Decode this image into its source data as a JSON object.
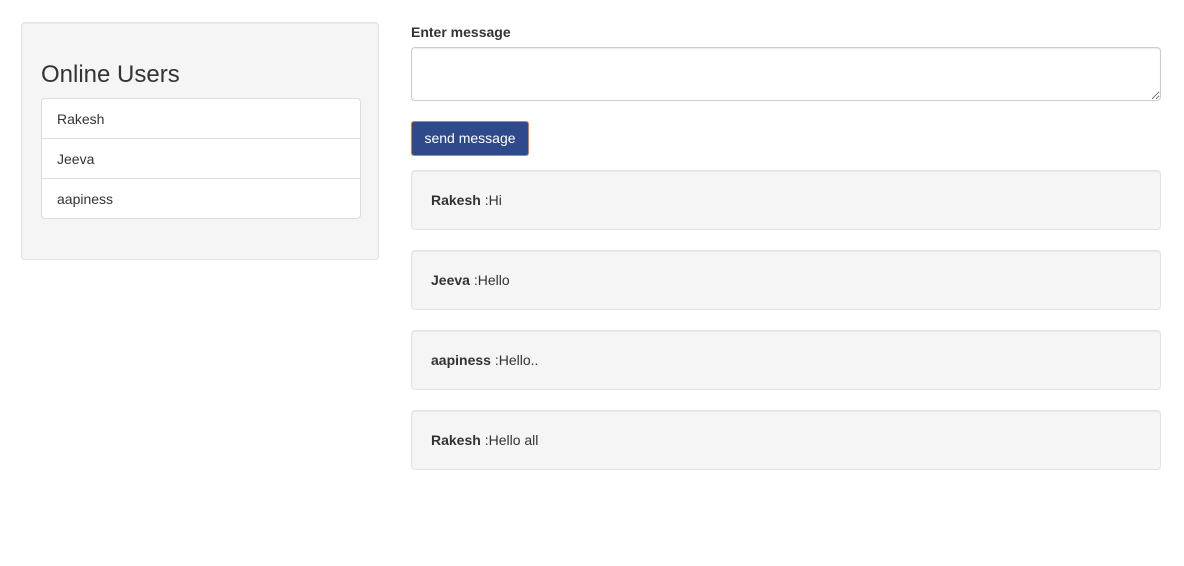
{
  "sidebar": {
    "title": "Online Users",
    "users": [
      "Rakesh",
      "Jeeva",
      "aapiness"
    ]
  },
  "composer": {
    "label": "Enter message",
    "value": "",
    "placeholder": "",
    "send_label": "send message"
  },
  "messages": [
    {
      "sender": "Rakesh",
      "text": " :Hi"
    },
    {
      "sender": "Jeeva",
      "text": " :Hello"
    },
    {
      "sender": "aapiness",
      "text": " :Hello.."
    },
    {
      "sender": "Rakesh",
      "text": " :Hello all"
    }
  ],
  "colors": {
    "button_bg": "#2e4a8c",
    "button_border": "#e07b3c",
    "well_bg": "#f5f5f5"
  }
}
